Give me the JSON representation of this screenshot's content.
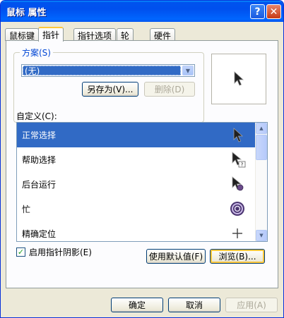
{
  "window": {
    "title": "鼠标 属性",
    "help_label": "?",
    "close_label": "✕"
  },
  "tabs": [
    {
      "label": "鼠标键"
    },
    {
      "label": "指针"
    },
    {
      "label": "指针选项"
    },
    {
      "label": "轮"
    },
    {
      "label": "硬件"
    }
  ],
  "active_tab": "指针",
  "scheme": {
    "legend": "方案(S)",
    "selected": "(无)",
    "save_as_label": "另存为(V)...",
    "delete_label": "删除(D)"
  },
  "custom": {
    "label": "自定义(C):",
    "items": [
      {
        "label": "正常选择",
        "icon": "normal-select-cursor-icon",
        "selected": true
      },
      {
        "label": "帮助选择",
        "icon": "help-select-cursor-icon",
        "selected": false
      },
      {
        "label": "后台运行",
        "icon": "working-in-background-cursor-icon",
        "selected": false
      },
      {
        "label": "忙",
        "icon": "busy-cursor-icon",
        "selected": false
      },
      {
        "label": "精确定位",
        "icon": "precision-select-cursor-icon",
        "selected": false
      }
    ]
  },
  "shadow": {
    "label": "启用指针阴影(E)",
    "checked": true
  },
  "use_default_label": "使用默认值(F)",
  "browse_label": "浏览(B)...",
  "footer": {
    "ok_label": "确定",
    "cancel_label": "取消",
    "apply_label": "应用(A)"
  },
  "colors": {
    "titlebar": "#0054e3",
    "selection": "#316ac5",
    "dialog_bg": "#ece9d8"
  }
}
